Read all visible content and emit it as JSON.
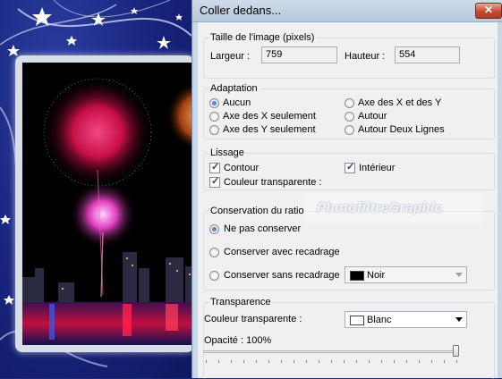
{
  "dialog": {
    "title": "Coller dedans...",
    "close_label": "✕"
  },
  "image_size": {
    "legend": "Taille de l'image (pixels)",
    "width_label": "Largeur :",
    "width_value": "759",
    "height_label": "Hauteur :",
    "height_value": "554"
  },
  "adaptation": {
    "legend": "Adaptation",
    "options": [
      "Aucun",
      "Axe des X seulement",
      "Axe des Y seulement",
      "Axe des X et des Y",
      "Autour",
      "Autour Deux Lignes"
    ],
    "selected": "Aucun"
  },
  "smoothing": {
    "legend": "Lissage",
    "contour_label": "Contour",
    "contour_checked": true,
    "interior_label": "Intérieur",
    "interior_checked": true,
    "transparent_label": "Couleur transparente :",
    "transparent_checked": true
  },
  "ratio": {
    "legend": "Conservation du ratio",
    "option_none": "Ne pas conserver",
    "option_crop": "Conserver avec recadrage",
    "option_nocrop": "Conserver sans recadrage",
    "selected": "Ne pas conserver",
    "fill_color_label": "Noir",
    "fill_color_hex": "#000000"
  },
  "transparency": {
    "legend": "Transparence",
    "color_label": "Couleur transparente :",
    "color_value": "Blanc",
    "color_hex": "#ffffff",
    "opacity_label": "Opacité : 100%",
    "opacity_percent": 100
  },
  "watermark": "PhotofiltreGraphic",
  "colors": {
    "background_blue": "#1b2a7a",
    "dialog_bg": "#f0f0f0",
    "close_red": "#c84a32"
  }
}
